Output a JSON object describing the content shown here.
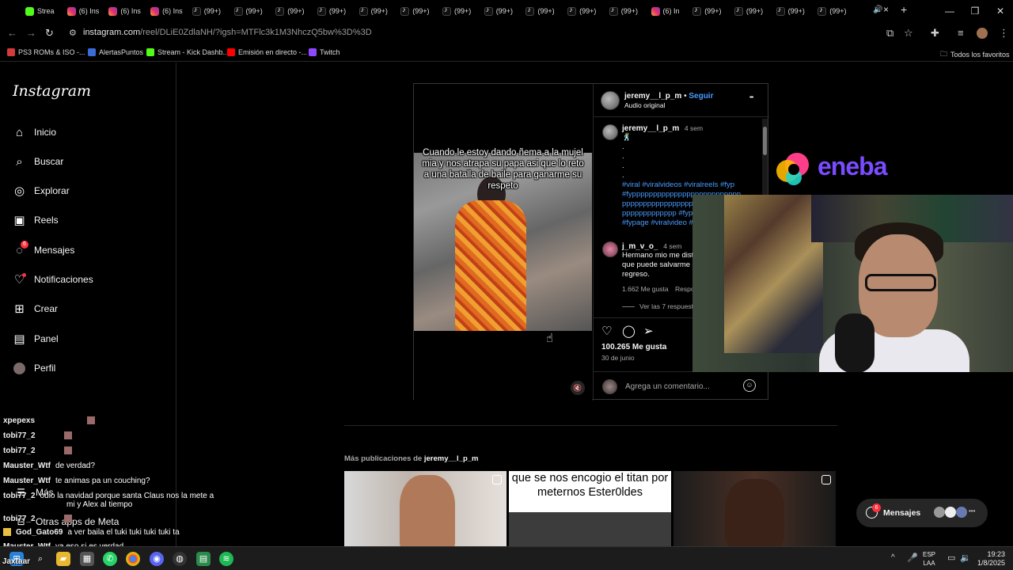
{
  "browser": {
    "tabs": [
      {
        "label": "Strea",
        "icon": "kick"
      },
      {
        "label": "(6) Ins",
        "icon": "instagram"
      },
      {
        "label": "(6) Ins",
        "icon": "instagram"
      },
      {
        "label": "(6) Ins",
        "icon": "instagram"
      },
      {
        "label": "(99+)",
        "icon": "tiktok"
      },
      {
        "label": "(99+)",
        "icon": "tiktok"
      },
      {
        "label": "(99+)",
        "icon": "tiktok"
      },
      {
        "label": "(99+)",
        "icon": "tiktok"
      },
      {
        "label": "(99+)",
        "icon": "tiktok"
      },
      {
        "label": "(99+)",
        "icon": "tiktok"
      },
      {
        "label": "(99+)",
        "icon": "tiktok"
      },
      {
        "label": "(99+)",
        "icon": "tiktok"
      },
      {
        "label": "(99+)",
        "icon": "tiktok"
      },
      {
        "label": "(99+)",
        "icon": "tiktok"
      },
      {
        "label": "(99+)",
        "icon": "tiktok"
      },
      {
        "label": "(6) In",
        "icon": "instagram"
      },
      {
        "label": "(99+)",
        "icon": "tiktok"
      },
      {
        "label": "(99+)",
        "icon": "tiktok"
      },
      {
        "label": "(99+)",
        "icon": "tiktok"
      },
      {
        "label": "(99+)",
        "icon": "tiktok"
      }
    ],
    "active_tab_close": "×",
    "new_tab": "+",
    "url_host": "instagram.com",
    "url_path": "/reel/DLiE0ZdlaNH/?igsh=MTFlc3k1M3NhczQ5bw%3D%3D",
    "bookmarks": [
      {
        "label": "PS3 ROMs & ISO -...",
        "color": "#d63b3b"
      },
      {
        "label": "AlertasPuntos",
        "color": "#3b6bd6"
      },
      {
        "label": "Stream - Kick Dashb...",
        "color": "#53fc18"
      },
      {
        "label": "Emisión en directo -...",
        "color": "#ff0000"
      },
      {
        "label": "Twitch",
        "color": "#9146ff"
      }
    ],
    "all_bookmarks": "Todos los favoritos"
  },
  "sidebar": {
    "logo": "Instagram",
    "items": [
      {
        "label": "Inicio",
        "icon": "home-icon"
      },
      {
        "label": "Buscar",
        "icon": "search-icon"
      },
      {
        "label": "Explorar",
        "icon": "compass-icon"
      },
      {
        "label": "Reels",
        "icon": "reels-icon"
      },
      {
        "label": "Mensajes",
        "icon": "messenger-icon",
        "badge": "6"
      },
      {
        "label": "Notificaciones",
        "icon": "heart-icon"
      },
      {
        "label": "Crear",
        "icon": "plus-icon"
      },
      {
        "label": "Panel",
        "icon": "chart-icon"
      },
      {
        "label": "Perfil",
        "icon": "avatar"
      }
    ],
    "more": "Más",
    "meta": "Otras apps de Meta"
  },
  "reel": {
    "caption_overlay": "Cuando le estoy dando ñema a la mujel mia y nos atrapa su papa asi que lo reto a una batalla de baile para ganarme su respeto",
    "author": "jeremy__l_p_m",
    "separator": "•",
    "follow": "Seguir",
    "audio": "Audio original",
    "more": "•••",
    "post_author": "jeremy__l_p_m",
    "post_age": "4 sem",
    "post_emoji": "🕺",
    "post_dots": ".",
    "hashtags_line1": "#viral #viralvideos #viralreels #fyp",
    "hashtags_line2": "#fypppppppppppppppppppppppppp",
    "hashtags_line3": "pppppppppppppppppppppppppppp",
    "hashtags_line4": "ppppppppppppp #fyp",
    "hashtags_line5": "#fypage #viralvideo #",
    "comment_user": "j_m_v_o_",
    "comment_age": "4 sem",
    "comment_text_1": "Hermano mio me dist",
    "comment_text_2": "que puede salvarme la",
    "comment_text_3": "regreso.",
    "comment_likes": "1.662 Me gusta",
    "comment_reply": "Respon",
    "view_replies": "Ver las 7 respuesta",
    "likes": "100.265 Me gusta",
    "date": "30 de junio",
    "comment_placeholder": "Agrega un comentario..."
  },
  "eneba": {
    "text": "eneba",
    "color": "#7a4bff"
  },
  "more_posts": {
    "label_prefix": "Más publicaciones de",
    "user": "jeremy__l_p_m",
    "thumb2_text": "que se nos encogio el titan por meternos Ester0ldes"
  },
  "messages_pill": {
    "label": "Mensajes",
    "badge": "6"
  },
  "chat": [
    {
      "user": "xpepexs",
      "msg": ""
    },
    {
      "user": "tobi77_2",
      "msg": ""
    },
    {
      "user": "tobi77_2",
      "msg": ""
    },
    {
      "user": "Mauster_Wtf",
      "msg": "de verdad?"
    },
    {
      "user": "Mauster_Wtf",
      "msg": "te animas pa un couching?"
    },
    {
      "user": "tobi77_2",
      "msg": "odio la navidad porque santa Claus nos la mete a"
    },
    {
      "user": "",
      "msg": "mi y Alex al tiempo"
    },
    {
      "user": "tobi77_2",
      "msg": ""
    },
    {
      "user": "God_Gato69",
      "msg": "a ver baila el tuki tuki tuki tuki ta"
    },
    {
      "user": "Mauster_Wtf",
      "msg": "ya eso si es verdad"
    },
    {
      "user": "Jaxtaar",
      "msg": ""
    }
  ],
  "taskbar": {
    "lang_1": "ESP",
    "lang_2": "LAA",
    "time": "19:23",
    "date": "1/8/2025",
    "chevron": "^"
  }
}
